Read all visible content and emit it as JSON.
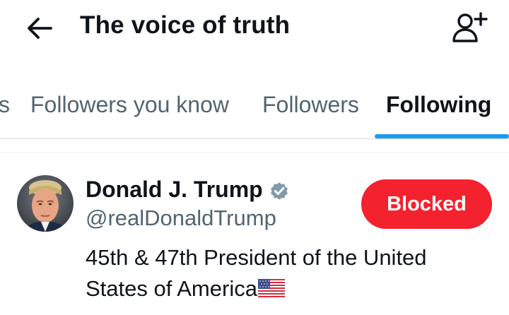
{
  "header": {
    "title": "The voice of truth",
    "back_icon": "arrow-left-icon",
    "follow_icon": "person-add-icon"
  },
  "tabs": [
    {
      "label": "s",
      "active": false
    },
    {
      "label": "Followers you know",
      "active": false
    },
    {
      "label": "Followers",
      "active": false
    },
    {
      "label": "Following",
      "active": true
    }
  ],
  "user": {
    "display_name": "Donald J. Trump",
    "handle": "@realDonaldTrump",
    "verified_icon": "verified-badge-icon",
    "blocked_label": "Blocked",
    "bio_line1": "45th & 47th President of the United",
    "bio_line2": "States of America",
    "flag_icon": "us-flag-icon"
  },
  "colors": {
    "accent": "#1d9bf0",
    "blocked": "#f4212e",
    "secondary_text": "#536471",
    "verified_badge": "#829aab"
  }
}
